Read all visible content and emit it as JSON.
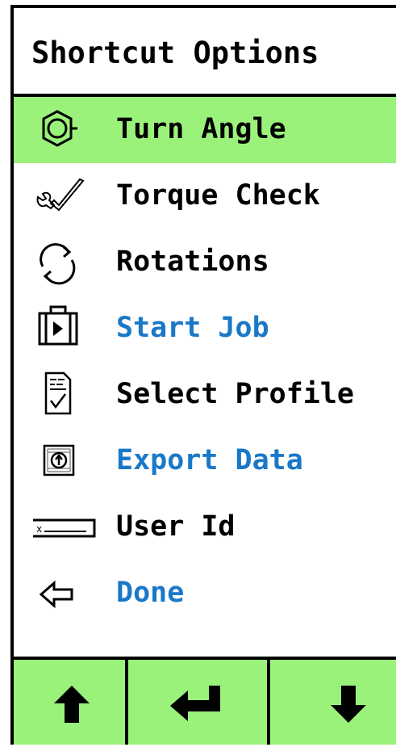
{
  "header": {
    "title": "Shortcut Options"
  },
  "menu": {
    "items": [
      {
        "label": "Turn Angle",
        "icon": "turn-angle-nut-icon",
        "selected": true,
        "color": "#000000"
      },
      {
        "label": "Torque Check",
        "icon": "torque-check-wrench-icon",
        "selected": false,
        "color": "#000000"
      },
      {
        "label": "Rotations",
        "icon": "rotations-cycle-icon",
        "selected": false,
        "color": "#000000"
      },
      {
        "label": "Start Job",
        "icon": "start-job-briefcase-play-icon",
        "selected": false,
        "color": "#1a78c8"
      },
      {
        "label": "Select Profile",
        "icon": "select-profile-clipboard-icon",
        "selected": false,
        "color": "#000000"
      },
      {
        "label": "Export Data",
        "icon": "export-data-icon",
        "selected": false,
        "color": "#1a78c8"
      },
      {
        "label": "User Id",
        "icon": "user-id-field-icon",
        "selected": false,
        "color": "#000000"
      },
      {
        "label": "Done",
        "icon": "back-arrow-icon",
        "selected": false,
        "color": "#1a78c8"
      }
    ]
  },
  "bottom_bar": {
    "buttons": [
      {
        "name": "up",
        "icon": "arrow-up-icon"
      },
      {
        "name": "enter",
        "icon": "enter-return-icon"
      },
      {
        "name": "down",
        "icon": "arrow-down-icon"
      }
    ]
  },
  "colors": {
    "highlight": "#9bf27b",
    "accent_blue": "#1a78c8",
    "text": "#000000"
  }
}
